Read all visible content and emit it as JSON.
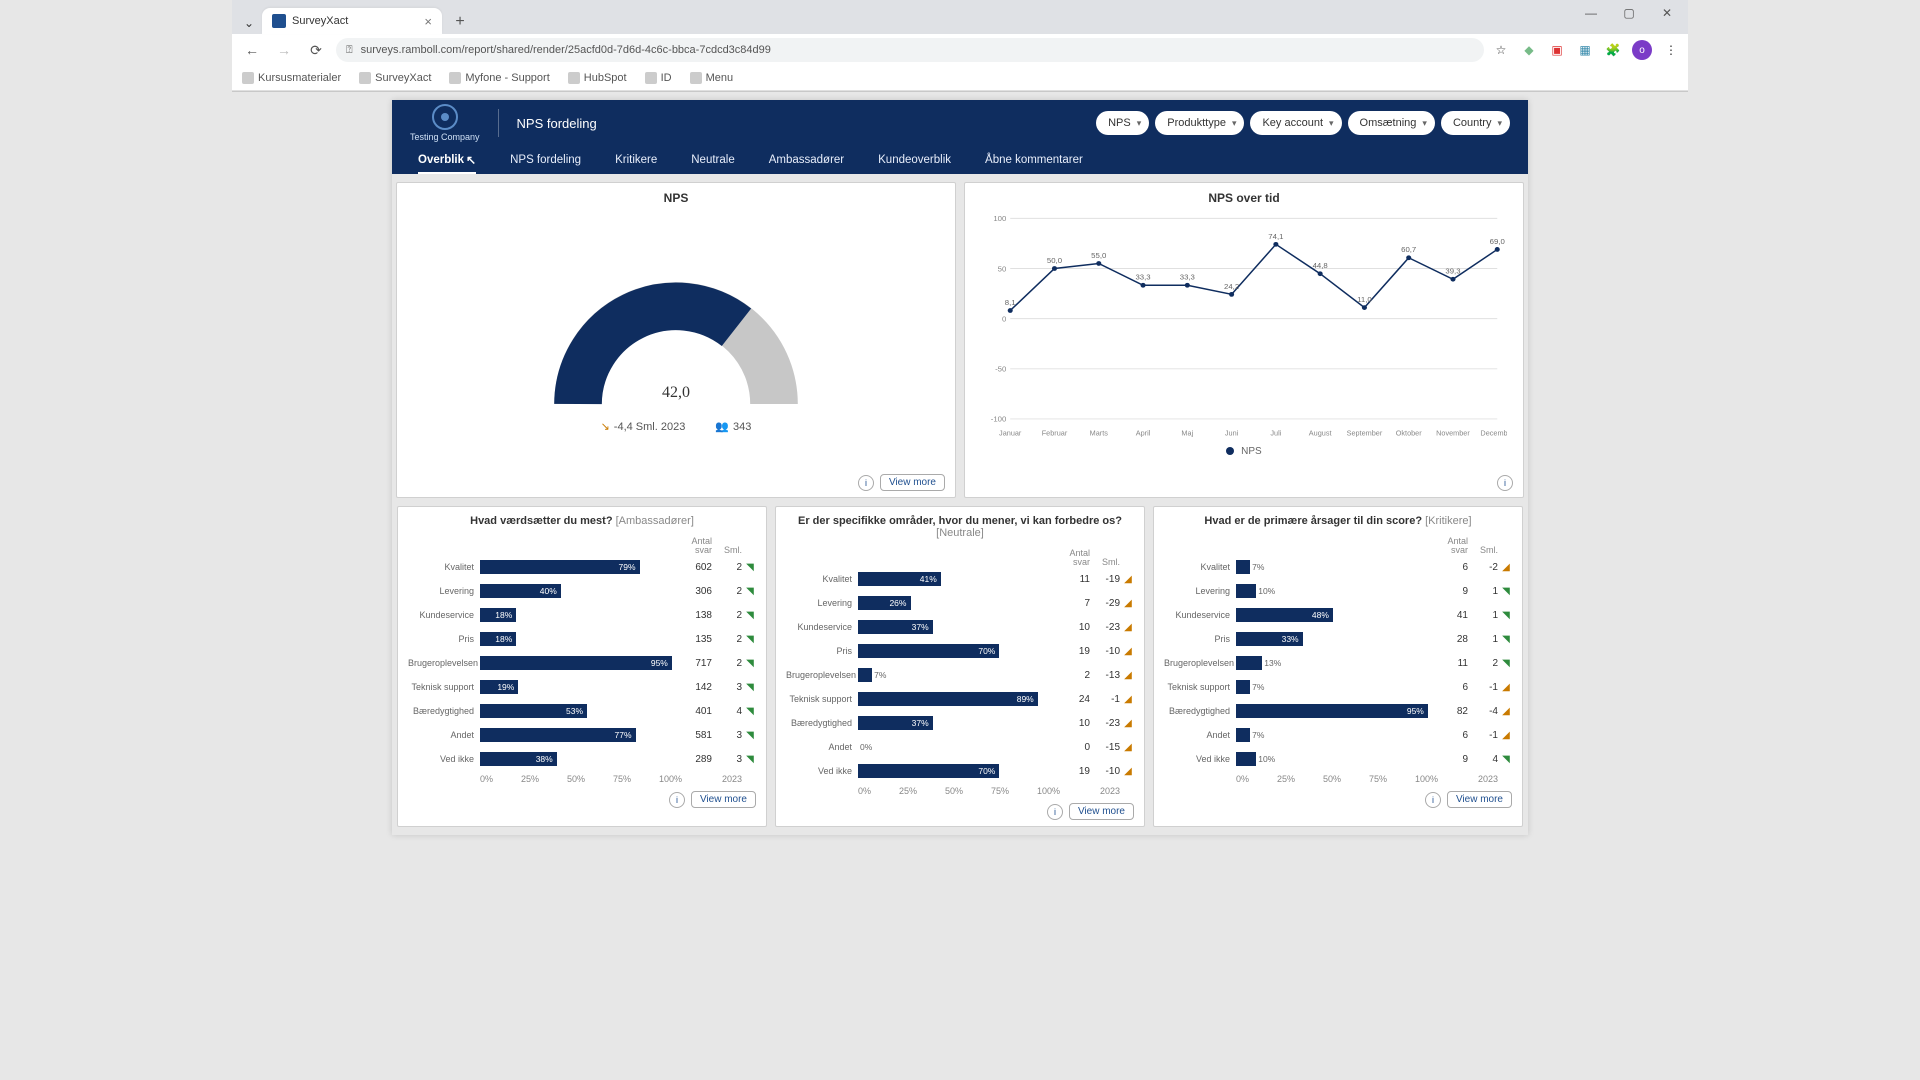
{
  "browser": {
    "tab_title": "SurveyXact",
    "url": "surveys.ramboll.com/report/shared/render/25acfd0d-7d6d-4c6c-bbca-7cdcd3c84d99",
    "bookmarks": [
      "Kursusmaterialer",
      "SurveyXact",
      "Myfone - Support",
      "HubSpot",
      "ID",
      "Menu"
    ]
  },
  "header": {
    "company": "Testing Company",
    "page_title": "NPS fordeling",
    "filters": [
      "NPS",
      "Produkttype",
      "Key account",
      "Omsætning",
      "Country"
    ],
    "nav": [
      "Overblik",
      "NPS fordeling",
      "Kritikere",
      "Neutrale",
      "Ambassadører",
      "Kundeoverblik",
      "Åbne kommentarer"
    ],
    "nav_active_index": 0
  },
  "cards": {
    "gauge": {
      "title": "NPS",
      "value_label": "42,0",
      "delta_label": "-4,4 Sml. 2023",
      "n_label": "343",
      "view_more": "View more"
    },
    "line": {
      "title": "NPS over tid",
      "legend": "NPS"
    },
    "bars1": {
      "title": "Hvad værdsætter du mest?",
      "subtitle_tag": "[Ambassadører]",
      "head_antal": "Antal\nsvar",
      "head_sml": "Sml.",
      "year": "2023",
      "view_more": "View more",
      "x_ticks": [
        "0%",
        "25%",
        "50%",
        "75%",
        "100%"
      ]
    },
    "bars2": {
      "title": "Er der specifikke områder, hvor du mener, vi kan forbedre os?",
      "subtitle_tag": "[Neutrale]",
      "head_antal": "Antal\nsvar",
      "head_sml": "Sml.",
      "year": "2023",
      "view_more": "View more",
      "x_ticks": [
        "0%",
        "25%",
        "50%",
        "75%",
        "100%"
      ]
    },
    "bars3": {
      "title": "Hvad er de primære årsager til din score?",
      "subtitle_tag": "[Kritikere]",
      "head_antal": "Antal\nsvar",
      "head_sml": "Sml.",
      "year": "2023",
      "view_more": "View more",
      "x_ticks": [
        "0%",
        "25%",
        "50%",
        "75%",
        "100%"
      ]
    }
  },
  "chart_data": [
    {
      "id": "gauge",
      "type": "gauge",
      "title": "NPS",
      "value": 42.0,
      "range": [
        -100,
        100
      ],
      "delta_vs_2023": -4.4,
      "n": 343
    },
    {
      "id": "nps_over_time",
      "type": "line",
      "title": "NPS over tid",
      "xlabel": "",
      "ylabel": "",
      "ylim": [
        -100,
        100
      ],
      "yticks": [
        -100,
        -50,
        0,
        50,
        100
      ],
      "categories": [
        "Januar",
        "Februar",
        "Marts",
        "April",
        "Maj",
        "Juni",
        "Juli",
        "August",
        "September",
        "Oktober",
        "November",
        "December"
      ],
      "series": [
        {
          "name": "NPS",
          "values": [
            8.1,
            50.0,
            55.0,
            33.3,
            33.3,
            24.2,
            74.1,
            44.8,
            11.0,
            60.7,
            39.3,
            69.0
          ]
        }
      ]
    },
    {
      "id": "bars_ambassadorer",
      "type": "bar",
      "title": "Hvad værdsætter du mest? [Ambassadører]",
      "xlabel": "",
      "ylabel": "",
      "ylim": [
        0,
        100
      ],
      "categories": [
        "Kvalitet",
        "Levering",
        "Kundeservice",
        "Pris",
        "Brugeroplevelsen",
        "Teknisk support",
        "Bæredygtighed",
        "Andet",
        "Ved ikke"
      ],
      "series": [
        {
          "name": "Procent",
          "values": [
            79,
            40,
            18,
            18,
            95,
            19,
            53,
            77,
            38
          ]
        },
        {
          "name": "Antal svar",
          "values": [
            602,
            306,
            138,
            135,
            717,
            142,
            401,
            581,
            289
          ]
        },
        {
          "name": "Sml.",
          "values": [
            2,
            2,
            2,
            2,
            2,
            3,
            4,
            3,
            3
          ]
        }
      ],
      "trend": [
        "up",
        "up",
        "up",
        "up",
        "up",
        "up",
        "up",
        "up",
        "up"
      ]
    },
    {
      "id": "bars_neutrale",
      "type": "bar",
      "title": "Er der specifikke områder, hvor du mener, vi kan forbedre os? [Neutrale]",
      "xlabel": "",
      "ylabel": "",
      "ylim": [
        0,
        100
      ],
      "categories": [
        "Kvalitet",
        "Levering",
        "Kundeservice",
        "Pris",
        "Brugeroplevelsen",
        "Teknisk support",
        "Bæredygtighed",
        "Andet",
        "Ved ikke"
      ],
      "series": [
        {
          "name": "Procent",
          "values": [
            41,
            26,
            37,
            70,
            7,
            89,
            37,
            0,
            70
          ]
        },
        {
          "name": "Antal svar",
          "values": [
            11,
            7,
            10,
            19,
            2,
            24,
            10,
            0,
            19
          ]
        },
        {
          "name": "Sml.",
          "values": [
            -19,
            -29,
            -23,
            -10,
            -13,
            -1,
            -23,
            -15,
            -10
          ]
        }
      ],
      "trend": [
        "down",
        "down",
        "down",
        "down",
        "down",
        "down",
        "down",
        "down",
        "down"
      ]
    },
    {
      "id": "bars_kritikere",
      "type": "bar",
      "title": "Hvad er de primære årsager til din score? [Kritikere]",
      "xlabel": "",
      "ylabel": "",
      "ylim": [
        0,
        100
      ],
      "categories": [
        "Kvalitet",
        "Levering",
        "Kundeservice",
        "Pris",
        "Brugeroplevelsen",
        "Teknisk support",
        "Bæredygtighed",
        "Andet",
        "Ved ikke"
      ],
      "series": [
        {
          "name": "Procent",
          "values": [
            7,
            10,
            48,
            33,
            13,
            7,
            95,
            7,
            10
          ]
        },
        {
          "name": "Antal svar",
          "values": [
            6,
            9,
            41,
            28,
            11,
            6,
            82,
            6,
            9
          ]
        },
        {
          "name": "Sml.",
          "values": [
            -2,
            1,
            1,
            1,
            2,
            -1,
            -4,
            -1,
            4
          ]
        }
      ],
      "trend": [
        "down",
        "up",
        "up",
        "up",
        "up",
        "down",
        "down",
        "down",
        "up"
      ]
    }
  ],
  "colors": {
    "brand_navy": "#0f2d5f",
    "gauge_bg": "#c7c7c7",
    "trend_up": "#2e8b3d",
    "trend_down": "#c97a00"
  }
}
